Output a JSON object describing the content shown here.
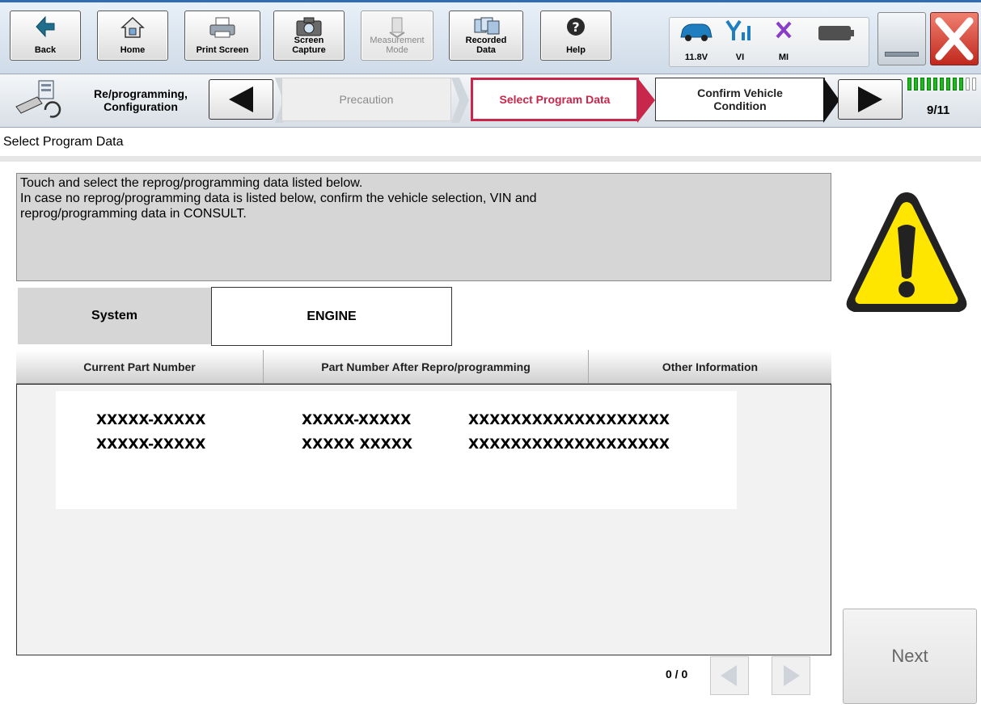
{
  "toolbar": {
    "back": "Back",
    "home": "Home",
    "print_screen": "Print Screen",
    "screen_capture": "Screen\nCapture",
    "measurement_mode": "Measurement\nMode",
    "recorded_data": "Recorded\nData",
    "help": "Help"
  },
  "status": {
    "voltage": "11.8V",
    "vi": "VI",
    "mi": "MI"
  },
  "steps": {
    "mode": "Re/programming,\nConfiguration",
    "prev": "Precaution",
    "current": "Select Program Data",
    "next": "Confirm Vehicle\nCondition",
    "counter": "9/11",
    "progress": {
      "done": 9,
      "total": 11
    }
  },
  "page": {
    "title": "Select Program Data",
    "instruction": "Touch and select the reprog/programming data listed below.\nIn case no reprog/programming data is listed below, confirm the vehicle selection, VIN and\nreprog/programming data in CONSULT."
  },
  "system": {
    "label": "System",
    "value": "ENGINE"
  },
  "table": {
    "columns": [
      "Current Part Number",
      "Part Number After Repro/programming",
      "Other Information"
    ],
    "rows": [
      [
        "XXXXX-XXXXX",
        "XXXXX-XXXXX",
        "XXXXXXXXXXXXXXXXXXX"
      ],
      [
        "XXXXX-XXXXX",
        "XXXXX XXXXX",
        "XXXXXXXXXXXXXXXXXXX"
      ]
    ]
  },
  "pager": {
    "count": "0 / 0"
  },
  "next_label": "Next",
  "colors": {
    "accent": "#c8264a",
    "progress": "#1fb81f",
    "panel_gray": "#d6d6d6"
  }
}
